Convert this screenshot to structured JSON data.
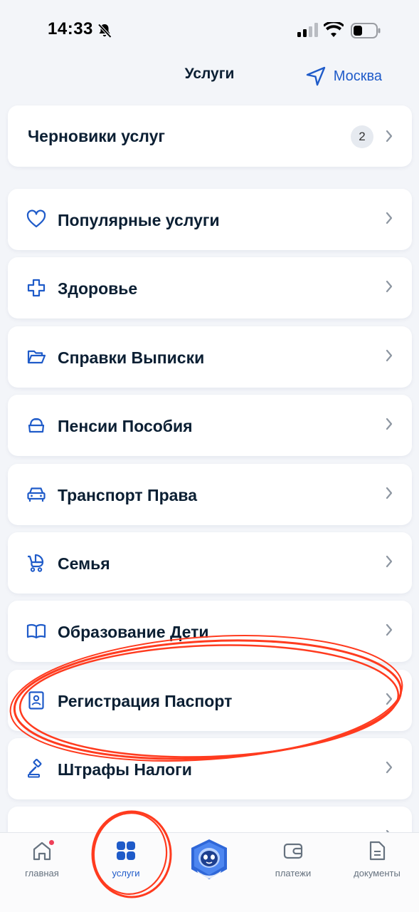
{
  "status_bar": {
    "time": "14:33"
  },
  "header": {
    "title": "Услуги",
    "location": "Москва"
  },
  "drafts": {
    "label": "Черновики услуг",
    "count": "2"
  },
  "menu_items": [
    {
      "label": "Популярные услуги",
      "icon": "heart-icon"
    },
    {
      "label": "Здоровье",
      "icon": "medical-cross-icon"
    },
    {
      "label": "Справки Выписки",
      "icon": "folder-icon"
    },
    {
      "label": "Пенсии Пособия",
      "icon": "piggy-bank-icon"
    },
    {
      "label": "Транспорт Права",
      "icon": "car-icon"
    },
    {
      "label": "Семья",
      "icon": "stroller-icon"
    },
    {
      "label": "Образование Дети",
      "icon": "book-icon"
    },
    {
      "label": "Регистрация Паспорт",
      "icon": "passport-icon"
    },
    {
      "label": "Штрафы Налоги",
      "icon": "gavel-icon"
    }
  ],
  "tab_bar": {
    "items": [
      {
        "label": "главная",
        "icon": "home-icon"
      },
      {
        "label": "услуги",
        "icon": "grid-icon",
        "active": true
      },
      {
        "label": "",
        "icon": "assistant-robot-icon"
      },
      {
        "label": "платежи",
        "icon": "wallet-icon"
      },
      {
        "label": "документы",
        "icon": "document-icon"
      }
    ]
  },
  "colors": {
    "accent": "#1f5bc9",
    "text": "#0b1f33",
    "background": "#f3f5f9",
    "annotation": "#ff3b1f",
    "badge": "#e6eaf0"
  }
}
